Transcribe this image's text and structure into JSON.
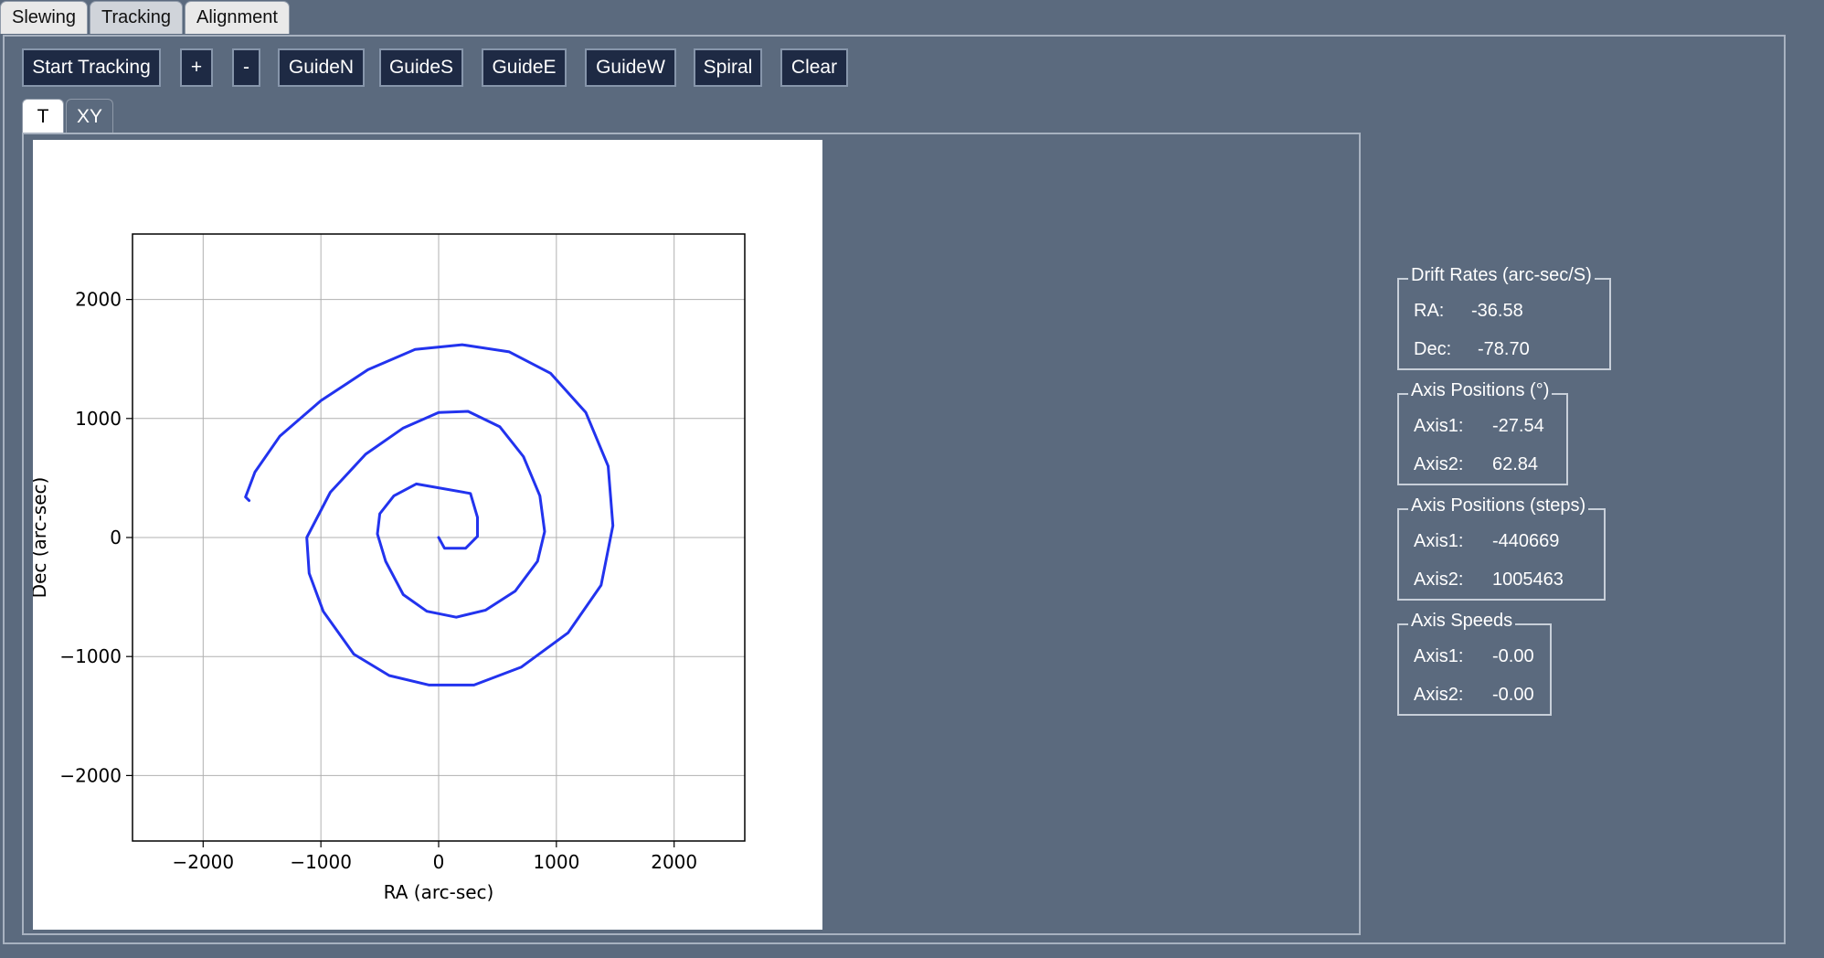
{
  "tabs": [
    "Slewing",
    "Tracking",
    "Alignment"
  ],
  "active_tab": "Tracking",
  "toolbar": {
    "start_tracking": "Start Tracking",
    "plus": "+",
    "minus": "-",
    "guide_n": "GuideN",
    "guide_s": "GuideS",
    "guide_e": "GuideE",
    "guide_w": "GuideW",
    "spiral": "Spiral",
    "clear": "Clear"
  },
  "subtabs": [
    "T",
    "XY"
  ],
  "active_subtab": "T",
  "drift_rates": {
    "title": "Drift Rates (arc-sec/S)",
    "ra_label": "RA:",
    "ra_value": "-36.58",
    "dec_label": "Dec:",
    "dec_value": "-78.70"
  },
  "axis_positions_deg": {
    "title": "Axis Positions (°)",
    "axis1_label": "Axis1:",
    "axis1_value": "-27.54",
    "axis2_label": "Axis2:",
    "axis2_value": "62.84"
  },
  "axis_positions_steps": {
    "title": "Axis Positions (steps)",
    "axis1_label": "Axis1:",
    "axis1_value": "-440669",
    "axis2_label": "Axis2:",
    "axis2_value": "1005463"
  },
  "axis_speeds": {
    "title": "Axis Speeds",
    "axis1_label": "Axis1:",
    "axis1_value": "-0.00",
    "axis2_label": "Axis2:",
    "axis2_value": "-0.00"
  },
  "colors": {
    "background": "#5b6a7e",
    "button": "#1e2a44",
    "series": "#2233ee"
  },
  "chart_data": {
    "type": "line",
    "xlabel": "RA (arc-sec)",
    "ylabel": "Dec (arc-sec)",
    "xlim": [
      -2600,
      2600
    ],
    "ylim": [
      -2550,
      2550
    ],
    "xticks": [
      -2000,
      -1000,
      0,
      1000,
      2000
    ],
    "yticks": [
      -2000,
      -1000,
      0,
      1000,
      2000
    ],
    "xtick_labels": [
      "−2000",
      "−1000",
      "0",
      "1000",
      "2000"
    ],
    "ytick_labels": [
      "−2000",
      "−1000",
      "0",
      "1000",
      "2000"
    ],
    "grid": true,
    "series": [
      {
        "x": [
          0,
          50,
          230,
          330,
          330,
          270,
          -190,
          -380,
          -500,
          -520,
          -450,
          -300,
          -100,
          150,
          400,
          650,
          840,
          900,
          860,
          720,
          520,
          250,
          0,
          -300,
          -620,
          -920,
          -1120,
          -1100,
          -980,
          -720,
          -420,
          -80,
          300,
          700,
          1100,
          1380,
          1480,
          1440,
          1250,
          950,
          600,
          200,
          -200,
          -600,
          -1000,
          -1350,
          -1560,
          -1640,
          -1610
        ],
        "y": [
          0,
          -90,
          -90,
          10,
          170,
          370,
          450,
          350,
          200,
          30,
          -200,
          -480,
          -620,
          -670,
          -610,
          -450,
          -200,
          50,
          350,
          680,
          930,
          1060,
          1050,
          920,
          700,
          380,
          0,
          -300,
          -620,
          -980,
          -1160,
          -1240,
          -1240,
          -1090,
          -800,
          -400,
          100,
          600,
          1050,
          1380,
          1560,
          1620,
          1580,
          1410,
          1150,
          850,
          550,
          340,
          310
        ]
      }
    ]
  }
}
